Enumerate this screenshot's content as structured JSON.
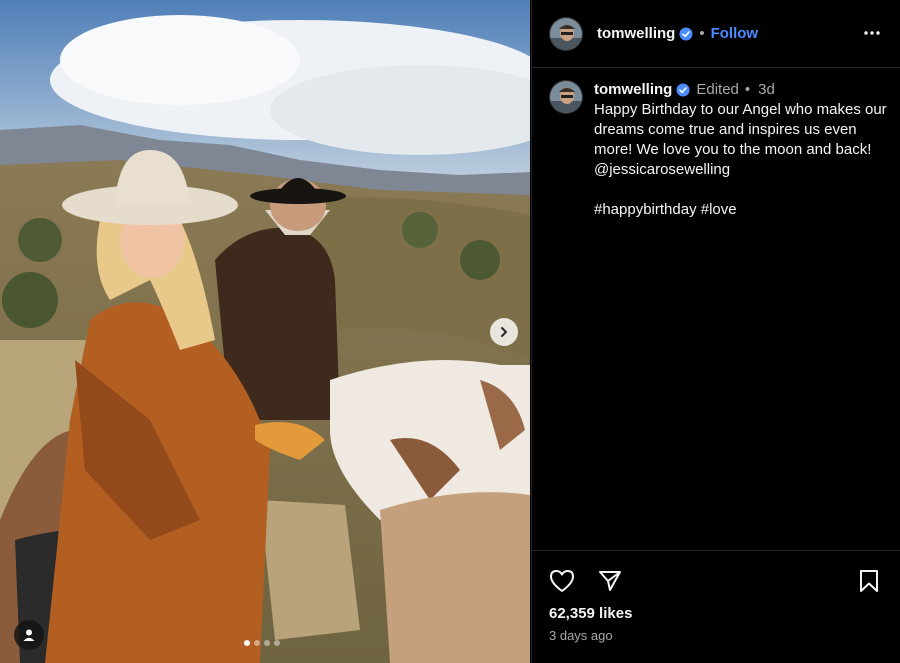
{
  "post": {
    "username": "tomwelling",
    "follow_label": "Follow",
    "separator": "•",
    "edited_label": "Edited",
    "edited_separator": "•",
    "relative_time": "3d",
    "caption": "Happy Birthday to our Angel who makes our dreams come true and inspires us even more! We love you to the moon and back! @jessicarosewelling\n\n#happybirthday #love",
    "likes": "62,359 likes",
    "posted_ago": "3 days ago"
  },
  "carousel": {
    "total": 4,
    "active_index": 0
  },
  "icons": {
    "verified": "verified-badge-icon",
    "more": "more-options-icon",
    "like": "heart-icon",
    "share": "share-icon",
    "save": "bookmark-icon",
    "next": "chevron-right-icon",
    "tag": "user-tag-icon"
  },
  "colors": {
    "accent": "#4a8cff",
    "background": "#000000",
    "muted": "#a8a8a8"
  }
}
